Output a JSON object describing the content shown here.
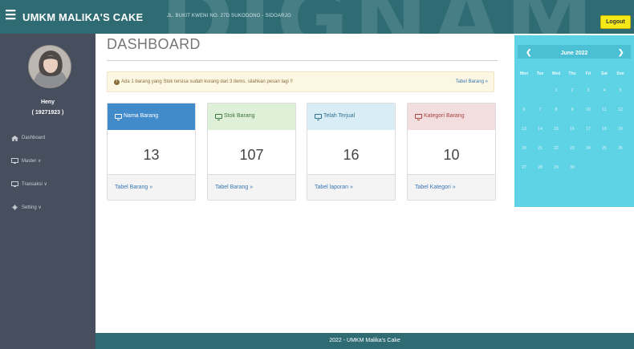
{
  "topbar": {
    "menu_icon": "hamburger-icon",
    "brand": "UMKM MALIKA'S CAKE",
    "address": "JL. BUKIT KWENI NO. 27D SUKODONO - SIDOARJO",
    "logout_label": "Logout",
    "logout_color": "#f5ea18"
  },
  "sidebar": {
    "user_name": "Heny",
    "user_id": "( 19271923 )",
    "items": [
      {
        "icon": "dashboard-icon",
        "label": "Dashboard"
      },
      {
        "icon": "monitor-icon",
        "label": "Master ∨"
      },
      {
        "icon": "monitor-icon",
        "label": "Transaksi ∨"
      },
      {
        "icon": "gear-icon",
        "label": "Setting ∨"
      }
    ]
  },
  "main": {
    "title": "DASHBOARD",
    "alert": {
      "icon": "info-icon",
      "text": "Ada 1 barang yang Stok tersisa sudah kurang dari 3 items. silahkan pesan lagi !!",
      "link": "Tabel Barang »"
    },
    "cards": [
      {
        "title": "Nama Barang",
        "value": "13",
        "link": "Tabel Barang »",
        "head_bg": "#428bca",
        "head_fg": "#ffffff"
      },
      {
        "title": "Stok Barang",
        "value": "107",
        "link": "Tabel Barang »",
        "head_bg": "#dff0d8",
        "head_fg": "#3c763d"
      },
      {
        "title": "Telah Terjual",
        "value": "16",
        "link": "Tabel laporan »",
        "head_bg": "#d9edf7",
        "head_fg": "#31708f"
      },
      {
        "title": "Kategori Barang",
        "value": "10",
        "link": "Tabel Kategori »",
        "head_bg": "#f2dede",
        "head_fg": "#a94442"
      }
    ]
  },
  "calendar": {
    "month": "June 2022",
    "prev_icon": "chevron-left-icon",
    "next_icon": "chevron-right-icon",
    "weekdays": [
      "Mon",
      "Tue",
      "Wed",
      "Thu",
      "Fri",
      "Sat",
      "Sun"
    ],
    "weeks": [
      [
        "",
        "",
        "1",
        "2",
        "3",
        "4",
        "5"
      ],
      [
        "6",
        "7",
        "8",
        "9",
        "10",
        "11",
        "12"
      ],
      [
        "13",
        "14",
        "15",
        "16",
        "17",
        "18",
        "19"
      ],
      [
        "20",
        "21",
        "22",
        "23",
        "24",
        "25",
        "26"
      ],
      [
        "27",
        "28",
        "29",
        "30",
        "",
        "",
        ""
      ]
    ]
  },
  "footer": {
    "text": "2022 - UMKM Malika's Cake"
  }
}
